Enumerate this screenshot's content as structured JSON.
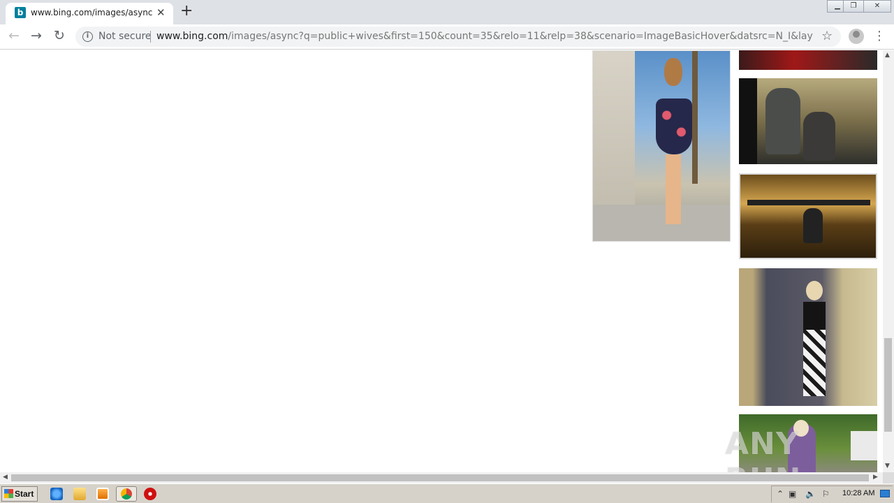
{
  "browser": {
    "tab": {
      "favicon_letter": "b",
      "title": "www.bing.com/images/async?q=pub"
    },
    "new_tab_glyph": "+",
    "address_bar": {
      "security_label": "Not secure",
      "url_host": "www.bing.com",
      "url_rest": "/images/async?q=public+wives&first=150&count=35&relo=11&relp=38&scenario=ImageBasicHover&datsrc=N_I&layout=ColumnBased&..."
    }
  },
  "page": {
    "images": [
      {
        "alt": "woman in floral dress on sidewalk"
      },
      {
        "alt": "red image partial"
      },
      {
        "alt": "people on subway"
      },
      {
        "alt": "person sitting in lobby"
      },
      {
        "alt": "woman at shooting range"
      },
      {
        "alt": "woman outdoors"
      }
    ],
    "watermark": "ANY RUN"
  },
  "taskbar": {
    "start_label": "Start",
    "clock": "10:28 AM",
    "icons": [
      "ie-icon",
      "folder-icon",
      "media-player-icon",
      "chrome-icon",
      "opera-icon"
    ]
  },
  "colors": {
    "tab_bar": "#dee1e6",
    "omnibox": "#f1f3f4",
    "bing_brand": "#00809d",
    "taskbar": "#d6d2ca"
  }
}
